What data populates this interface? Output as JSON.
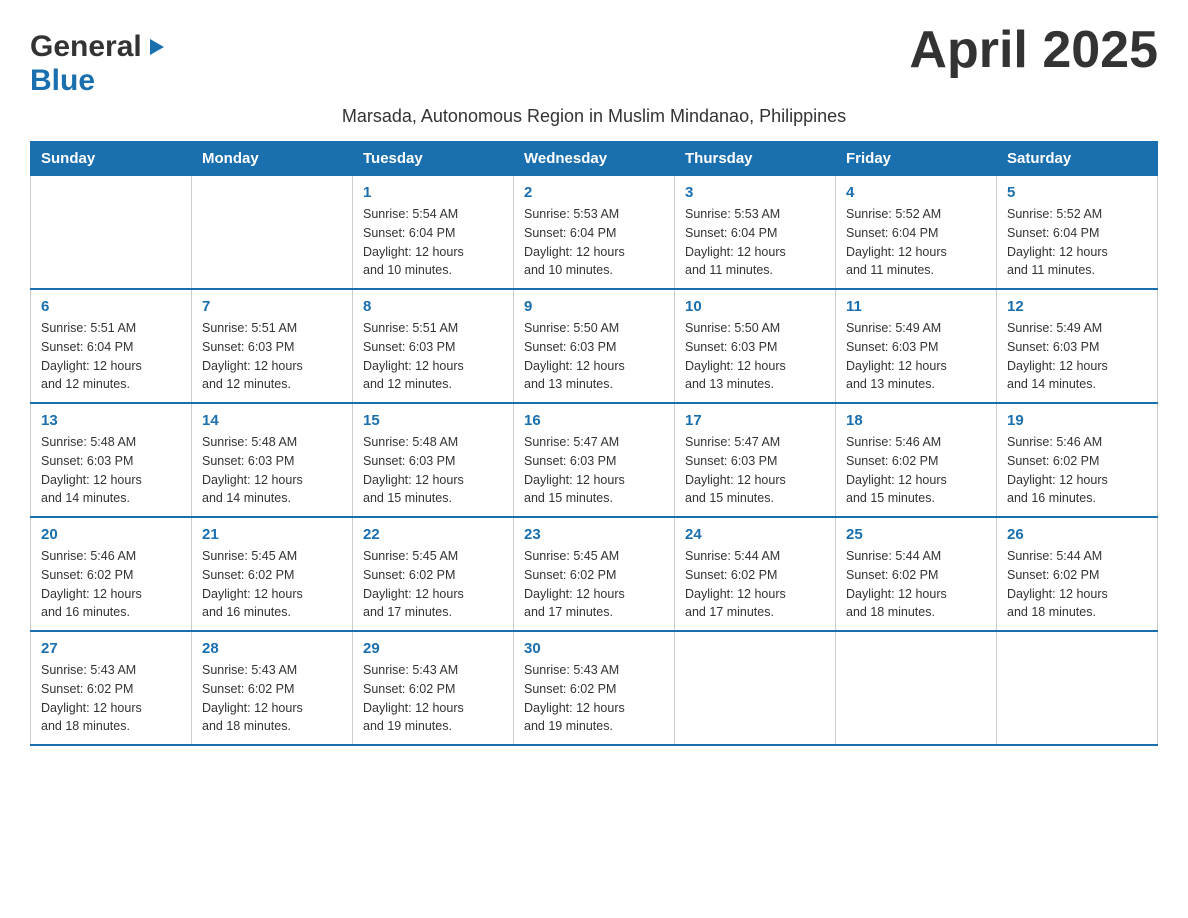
{
  "header": {
    "logo_general": "General",
    "logo_blue": "Blue",
    "month_title": "April 2025",
    "subtitle": "Marsada, Autonomous Region in Muslim Mindanao, Philippines"
  },
  "weekdays": [
    "Sunday",
    "Monday",
    "Tuesday",
    "Wednesday",
    "Thursday",
    "Friday",
    "Saturday"
  ],
  "weeks": [
    [
      {
        "day": "",
        "info": ""
      },
      {
        "day": "",
        "info": ""
      },
      {
        "day": "1",
        "info": "Sunrise: 5:54 AM\nSunset: 6:04 PM\nDaylight: 12 hours\nand 10 minutes."
      },
      {
        "day": "2",
        "info": "Sunrise: 5:53 AM\nSunset: 6:04 PM\nDaylight: 12 hours\nand 10 minutes."
      },
      {
        "day": "3",
        "info": "Sunrise: 5:53 AM\nSunset: 6:04 PM\nDaylight: 12 hours\nand 11 minutes."
      },
      {
        "day": "4",
        "info": "Sunrise: 5:52 AM\nSunset: 6:04 PM\nDaylight: 12 hours\nand 11 minutes."
      },
      {
        "day": "5",
        "info": "Sunrise: 5:52 AM\nSunset: 6:04 PM\nDaylight: 12 hours\nand 11 minutes."
      }
    ],
    [
      {
        "day": "6",
        "info": "Sunrise: 5:51 AM\nSunset: 6:04 PM\nDaylight: 12 hours\nand 12 minutes."
      },
      {
        "day": "7",
        "info": "Sunrise: 5:51 AM\nSunset: 6:03 PM\nDaylight: 12 hours\nand 12 minutes."
      },
      {
        "day": "8",
        "info": "Sunrise: 5:51 AM\nSunset: 6:03 PM\nDaylight: 12 hours\nand 12 minutes."
      },
      {
        "day": "9",
        "info": "Sunrise: 5:50 AM\nSunset: 6:03 PM\nDaylight: 12 hours\nand 13 minutes."
      },
      {
        "day": "10",
        "info": "Sunrise: 5:50 AM\nSunset: 6:03 PM\nDaylight: 12 hours\nand 13 minutes."
      },
      {
        "day": "11",
        "info": "Sunrise: 5:49 AM\nSunset: 6:03 PM\nDaylight: 12 hours\nand 13 minutes."
      },
      {
        "day": "12",
        "info": "Sunrise: 5:49 AM\nSunset: 6:03 PM\nDaylight: 12 hours\nand 14 minutes."
      }
    ],
    [
      {
        "day": "13",
        "info": "Sunrise: 5:48 AM\nSunset: 6:03 PM\nDaylight: 12 hours\nand 14 minutes."
      },
      {
        "day": "14",
        "info": "Sunrise: 5:48 AM\nSunset: 6:03 PM\nDaylight: 12 hours\nand 14 minutes."
      },
      {
        "day": "15",
        "info": "Sunrise: 5:48 AM\nSunset: 6:03 PM\nDaylight: 12 hours\nand 15 minutes."
      },
      {
        "day": "16",
        "info": "Sunrise: 5:47 AM\nSunset: 6:03 PM\nDaylight: 12 hours\nand 15 minutes."
      },
      {
        "day": "17",
        "info": "Sunrise: 5:47 AM\nSunset: 6:03 PM\nDaylight: 12 hours\nand 15 minutes."
      },
      {
        "day": "18",
        "info": "Sunrise: 5:46 AM\nSunset: 6:02 PM\nDaylight: 12 hours\nand 15 minutes."
      },
      {
        "day": "19",
        "info": "Sunrise: 5:46 AM\nSunset: 6:02 PM\nDaylight: 12 hours\nand 16 minutes."
      }
    ],
    [
      {
        "day": "20",
        "info": "Sunrise: 5:46 AM\nSunset: 6:02 PM\nDaylight: 12 hours\nand 16 minutes."
      },
      {
        "day": "21",
        "info": "Sunrise: 5:45 AM\nSunset: 6:02 PM\nDaylight: 12 hours\nand 16 minutes."
      },
      {
        "day": "22",
        "info": "Sunrise: 5:45 AM\nSunset: 6:02 PM\nDaylight: 12 hours\nand 17 minutes."
      },
      {
        "day": "23",
        "info": "Sunrise: 5:45 AM\nSunset: 6:02 PM\nDaylight: 12 hours\nand 17 minutes."
      },
      {
        "day": "24",
        "info": "Sunrise: 5:44 AM\nSunset: 6:02 PM\nDaylight: 12 hours\nand 17 minutes."
      },
      {
        "day": "25",
        "info": "Sunrise: 5:44 AM\nSunset: 6:02 PM\nDaylight: 12 hours\nand 18 minutes."
      },
      {
        "day": "26",
        "info": "Sunrise: 5:44 AM\nSunset: 6:02 PM\nDaylight: 12 hours\nand 18 minutes."
      }
    ],
    [
      {
        "day": "27",
        "info": "Sunrise: 5:43 AM\nSunset: 6:02 PM\nDaylight: 12 hours\nand 18 minutes."
      },
      {
        "day": "28",
        "info": "Sunrise: 5:43 AM\nSunset: 6:02 PM\nDaylight: 12 hours\nand 18 minutes."
      },
      {
        "day": "29",
        "info": "Sunrise: 5:43 AM\nSunset: 6:02 PM\nDaylight: 12 hours\nand 19 minutes."
      },
      {
        "day": "30",
        "info": "Sunrise: 5:43 AM\nSunset: 6:02 PM\nDaylight: 12 hours\nand 19 minutes."
      },
      {
        "day": "",
        "info": ""
      },
      {
        "day": "",
        "info": ""
      },
      {
        "day": "",
        "info": ""
      }
    ]
  ]
}
